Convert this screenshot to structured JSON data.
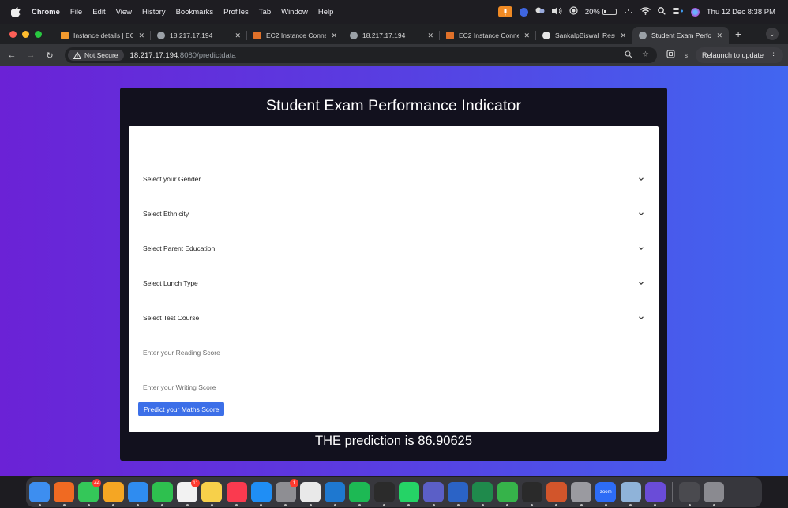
{
  "menubar": {
    "items": [
      "Chrome",
      "File",
      "Edit",
      "View",
      "History",
      "Bookmarks",
      "Profiles",
      "Tab",
      "Window",
      "Help"
    ],
    "battery_percent": "20%",
    "datetime": "Thu 12 Dec  8:38 PM"
  },
  "tabs": [
    {
      "title": "Instance details | EC",
      "icon": "aws-console-icon",
      "color": "#f29a2e",
      "active": false
    },
    {
      "title": "18.217.17.194",
      "icon": "globe-icon",
      "color": "#9aa0a6",
      "active": false
    },
    {
      "title": "EC2 Instance Conne",
      "icon": "aws-cube-icon",
      "color": "#e0712a",
      "active": false
    },
    {
      "title": "18.217.17.194",
      "icon": "globe-icon",
      "color": "#9aa0a6",
      "active": false
    },
    {
      "title": "EC2 Instance Conne",
      "icon": "aws-cube-icon",
      "color": "#e0712a",
      "active": false
    },
    {
      "title": "SankalpBiswal_Resu",
      "icon": "github-icon",
      "color": "#e6e6e6",
      "active": false
    },
    {
      "title": "Student Exam Perfo",
      "icon": "globe-icon",
      "color": "#9aa0a6",
      "active": true
    }
  ],
  "toolbar": {
    "not_secure_label": "Not Secure",
    "url_host": "18.217.17.194",
    "url_path": ":8080/predictdata",
    "relaunch_label": "Relaunch to update"
  },
  "page": {
    "title": "Student Exam Performance Indicator",
    "fields": [
      {
        "label": "Select your Gender",
        "kind": "select"
      },
      {
        "label": "Select Ethnicity",
        "kind": "select"
      },
      {
        "label": "Select Parent Education",
        "kind": "select"
      },
      {
        "label": "Select Lunch Type",
        "kind": "select"
      },
      {
        "label": "Select Test Course",
        "kind": "select"
      },
      {
        "label": "Enter your Reading Score",
        "kind": "input"
      },
      {
        "label": "Enter your Writing Score",
        "kind": "input"
      }
    ],
    "submit_label": "Predict your Maths Score",
    "result_text": "THE prediction is 86.90625"
  },
  "dock": {
    "apps": [
      {
        "name": "finder-icon",
        "color": "#3d8ef0"
      },
      {
        "name": "firefox-icon",
        "color": "#f06a22"
      },
      {
        "name": "messages-icon",
        "color": "#34c759",
        "badge": "44"
      },
      {
        "name": "photos-icon",
        "color": "#f5a623"
      },
      {
        "name": "safari-icon",
        "color": "#2f8cf0"
      },
      {
        "name": "facetime-icon",
        "color": "#2ec04f"
      },
      {
        "name": "reminders-icon",
        "color": "#f2f2f2",
        "badge": "11"
      },
      {
        "name": "notes-icon",
        "color": "#f7d04a"
      },
      {
        "name": "music-icon",
        "color": "#fa3a4f"
      },
      {
        "name": "app-store-icon",
        "color": "#1f8ef5"
      },
      {
        "name": "system-settings-icon",
        "color": "#8e8e93",
        "badge": "1"
      },
      {
        "name": "chrome-icon",
        "color": "#e9e9e9"
      },
      {
        "name": "vscode-icon",
        "color": "#1e78d0"
      },
      {
        "name": "spotify-icon",
        "color": "#1db954"
      },
      {
        "name": "activity-monitor-icon",
        "color": "#2b2b2b"
      },
      {
        "name": "whatsapp-icon",
        "color": "#25d366"
      },
      {
        "name": "teams-icon",
        "color": "#5b5fc7"
      },
      {
        "name": "word-icon",
        "color": "#2b63c6"
      },
      {
        "name": "excel-icon",
        "color": "#1f8a4c"
      },
      {
        "name": "numbers-icon",
        "color": "#36b34a"
      },
      {
        "name": "terminal-icon",
        "color": "#2a2a2a"
      },
      {
        "name": "powerpoint-icon",
        "color": "#d2552b"
      },
      {
        "name": "disk-utility-icon",
        "color": "#9a9aa0"
      },
      {
        "name": "zoom-icon",
        "color": "#2d6cf6"
      },
      {
        "name": "preview-icon",
        "color": "#8fb3d9"
      },
      {
        "name": "imovie-icon",
        "color": "#6a4cd8"
      },
      {
        "name": "photo-booth-icon",
        "color": "#4a4a4f"
      },
      {
        "name": "trash-icon",
        "color": "#8a8a90"
      }
    ],
    "zoom_label": "zoom"
  }
}
